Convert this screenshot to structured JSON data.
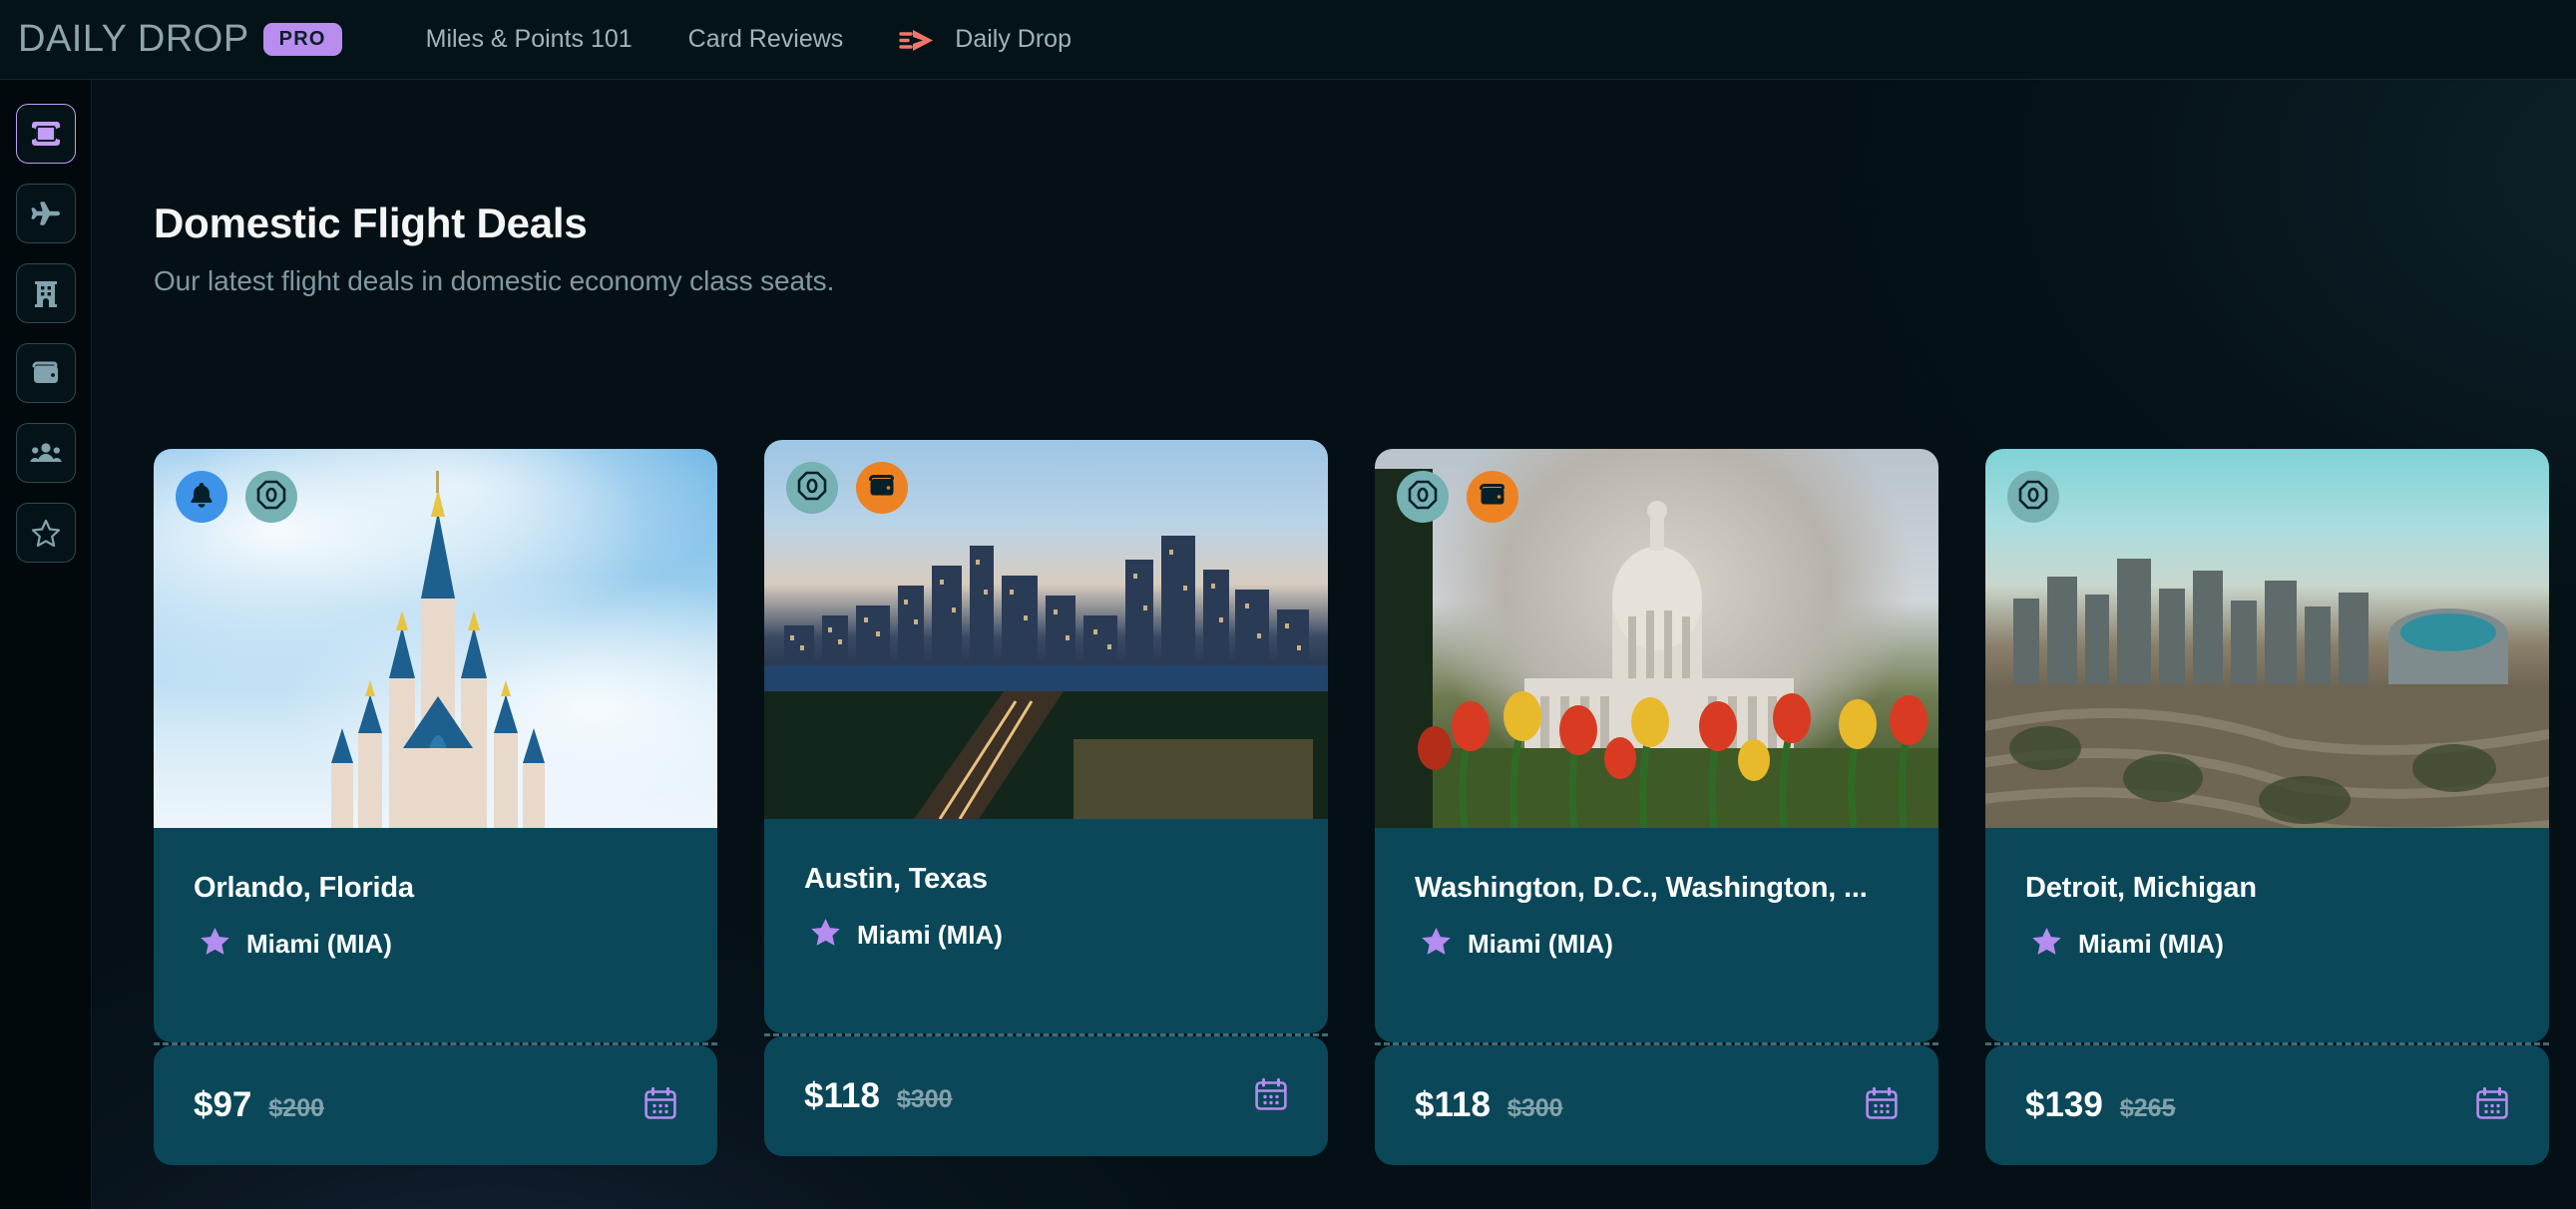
{
  "topbar": {
    "brand_text": "DAILY DROP",
    "brand_icon": "drop-logo-icon",
    "pro_badge": "PRO",
    "nav": [
      {
        "label": "Miles & Points 101",
        "icon": null
      },
      {
        "label": "Card Reviews",
        "icon": null
      },
      {
        "label": "Daily Drop",
        "icon": "send-arrow-icon"
      }
    ]
  },
  "sidebar": {
    "items": [
      {
        "name": "deals",
        "icon": "ticket-icon",
        "active": true
      },
      {
        "name": "flights",
        "icon": "airplane-icon",
        "active": false
      },
      {
        "name": "hotels",
        "icon": "hotel-icon",
        "active": false
      },
      {
        "name": "cards",
        "icon": "wallet-icon",
        "active": false
      },
      {
        "name": "community",
        "icon": "people-icon",
        "active": false
      },
      {
        "name": "favorites",
        "icon": "star-icon",
        "active": false
      }
    ]
  },
  "main": {
    "title": "Domestic Flight Deals",
    "subtitle": "Our latest flight deals in domestic economy class seats."
  },
  "cards": [
    {
      "city": "Orlando, Florida",
      "origin": "Miami (MIA)",
      "origin_icon": "star-icon",
      "price": "$97",
      "was_price": "$200",
      "calendar_icon": "calendar-icon",
      "badges": [
        {
          "name": "alert-badge",
          "icon": "bell-icon",
          "color": "#3c93e8"
        },
        {
          "name": "points-badge",
          "icon": "zero-octagon-icon",
          "color": "#76b1b4",
          "text": "0"
        }
      ],
      "photo": "orlando-castle-photo"
    },
    {
      "city": "Austin, Texas",
      "origin": "Miami (MIA)",
      "origin_icon": "star-icon",
      "price": "$118",
      "was_price": "$300",
      "calendar_icon": "calendar-icon",
      "badges": [
        {
          "name": "points-badge",
          "icon": "zero-octagon-icon",
          "color": "#76b1b4",
          "text": "0"
        },
        {
          "name": "cash-badge",
          "icon": "wallet-icon",
          "color": "#ec8222"
        }
      ],
      "photo": "austin-skyline-photo"
    },
    {
      "city": "Washington, D.C., Washington, ...",
      "origin": "Miami (MIA)",
      "origin_icon": "star-icon",
      "price": "$118",
      "was_price": "$300",
      "calendar_icon": "calendar-icon",
      "badges": [
        {
          "name": "points-badge",
          "icon": "zero-octagon-icon",
          "color": "#76b1b4",
          "text": "0"
        },
        {
          "name": "cash-badge",
          "icon": "wallet-icon",
          "color": "#ec8222"
        }
      ],
      "photo": "washington-capitol-photo"
    },
    {
      "city": "Detroit, Michigan",
      "origin": "Miami (MIA)",
      "origin_icon": "star-icon",
      "price": "$139",
      "was_price": "$265",
      "calendar_icon": "calendar-icon",
      "badges": [
        {
          "name": "points-badge",
          "icon": "zero-octagon-icon",
          "color": "#76b1b4",
          "text": "0"
        }
      ],
      "photo": "detroit-skyline-photo"
    }
  ],
  "colors": {
    "page_bg": "#02090c",
    "card_bg": "#0a4759",
    "accent_purple": "#b98cf0",
    "accent_coral": "#f4756b",
    "muted_text": "#7f99a2"
  }
}
